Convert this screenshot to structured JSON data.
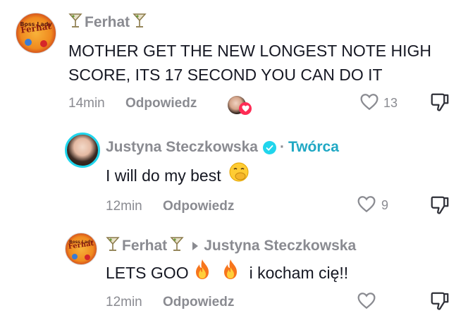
{
  "comments": [
    {
      "author": "Ferhat",
      "text_line1": "MOTHER GET THE NEW LONGEST NOTE HIGH",
      "text_line2": "SCORE, ITS 17 SECOND YOU CAN DO IT",
      "time": "14min",
      "reply_label": "Odpowiedz",
      "likes": "13",
      "avatar_logo_top": "Boss Lady",
      "avatar_logo_text": "Ferhat"
    },
    {
      "author": "Justyna Steczkowska",
      "creator_label": "Twórca",
      "text": "I will do my best",
      "time": "12min",
      "reply_label": "Odpowiedz",
      "likes": "9"
    },
    {
      "author": "Ferhat",
      "reply_to": "Justyna Steczkowska",
      "text_part1": "LETS GOO",
      "text_part2": "i kocham cię!!",
      "time": "12min",
      "reply_label": "Odpowiedz",
      "avatar_logo_top": "Boss Lady",
      "avatar_logo_text": "Ferhat"
    }
  ],
  "icons": {
    "glass": "cocktail-glass-icon",
    "heart": "heart-outline-icon",
    "dislike": "thumbs-down-icon",
    "verified": "verified-badge-icon",
    "fire": "fire-emoji-icon",
    "smile": "hand-over-mouth-emoji-icon"
  },
  "colors": {
    "text": "#161823",
    "muted": "#8a8b91",
    "creator": "#20a8c4",
    "verified": "#20d5ec",
    "heart_badge": "#fe2c55"
  }
}
